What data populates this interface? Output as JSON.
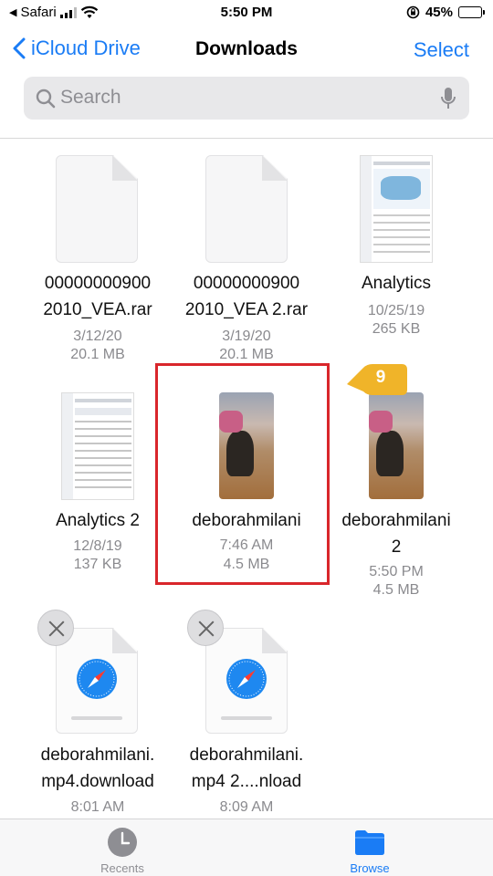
{
  "status": {
    "back_app": "Safari",
    "time": "5:50 PM",
    "battery": "45%",
    "battery_level": 0.45
  },
  "nav": {
    "back_label": "iCloud Drive",
    "title": "Downloads",
    "select_label": "Select"
  },
  "search": {
    "placeholder": "Search"
  },
  "files": [
    {
      "name_line1": "00000000900",
      "name_line2": "2010_VEA.rar",
      "date": "3/12/20",
      "size": "20.1 MB"
    },
    {
      "name_line1": "00000000900",
      "name_line2": "2010_VEA 2.rar",
      "date": "3/19/20",
      "size": "20.1 MB"
    },
    {
      "name_line1": "Analytics",
      "name_line2": "",
      "date": "10/25/19",
      "size": "265 KB"
    },
    {
      "name_line1": "Analytics 2",
      "name_line2": "",
      "date": "12/8/19",
      "size": "137 KB"
    },
    {
      "name_line1": "deborahmilani",
      "name_line2": "",
      "date": "7:46 AM",
      "size": "4.5 MB"
    },
    {
      "name_line1": "deborahmilani",
      "name_line2": "2",
      "date": "5:50 PM",
      "size": "4.5 MB"
    },
    {
      "name_line1": "deborahmilani.",
      "name_line2": "mp4.download",
      "date": "8:01 AM",
      "size": ""
    },
    {
      "name_line1": "deborahmilani.",
      "name_line2": "mp4 2....nload",
      "date": "8:09 AM",
      "size": ""
    }
  ],
  "step_badge": "9",
  "tabbar": {
    "recents": "Recents",
    "browse": "Browse"
  },
  "colors": {
    "accent": "#1a7cf5",
    "highlight": "#d9262b",
    "step_badge": "#f0b429"
  }
}
